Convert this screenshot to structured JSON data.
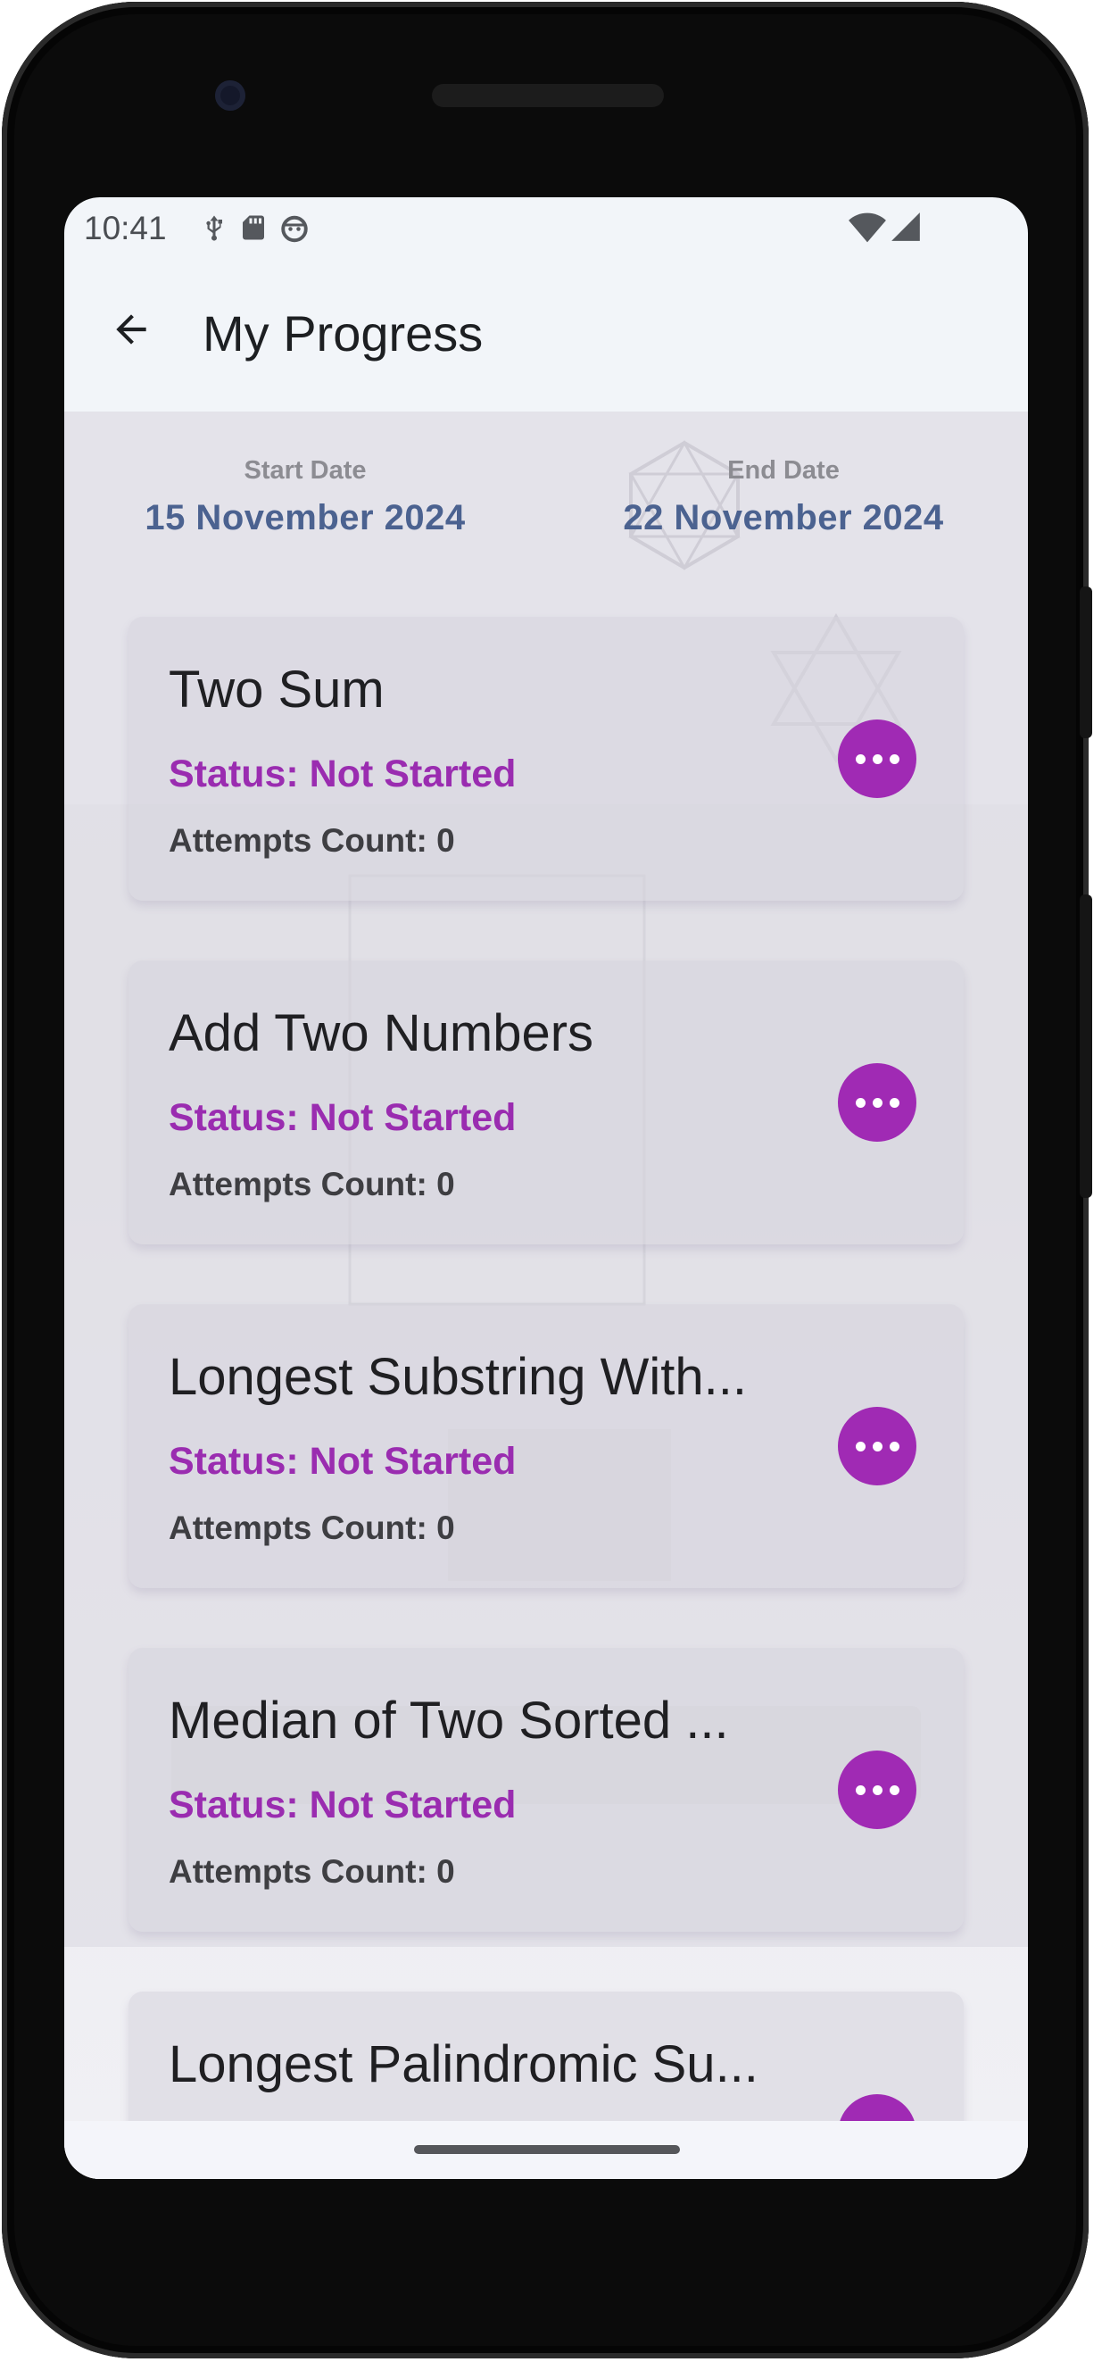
{
  "status_bar": {
    "time": "10:41",
    "left_icons": [
      "usb-debug-icon",
      "sd-card-icon",
      "android-icon"
    ],
    "right_icons": [
      "wifi-icon",
      "cell-signal-icon"
    ]
  },
  "app_bar": {
    "back_icon": "arrow-back-icon",
    "title": "My Progress"
  },
  "date_range": {
    "start_label": "Start Date",
    "start_value": "15 November 2024",
    "end_label": "End Date",
    "end_value": "22 November 2024"
  },
  "problems": [
    {
      "title": "Two Sum",
      "status": "Status: Not Started",
      "attempts": "Attempts Count: 0"
    },
    {
      "title": "Add Two Numbers",
      "status": "Status: Not Started",
      "attempts": "Attempts Count: 0"
    },
    {
      "title": "Longest Substring With...",
      "status": "Status: Not Started",
      "attempts": "Attempts Count: 0"
    },
    {
      "title": "Median of Two Sorted ...",
      "status": "Status: Not Started",
      "attempts": "Attempts Count: 0"
    },
    {
      "title": "Longest Palindromic Su...",
      "status": "",
      "attempts": ""
    }
  ],
  "colors": {
    "accent": "#a02ab4",
    "status_text": "#9a2cb0",
    "date_value": "#4b6290",
    "screen_bg": "#f2f5f9"
  }
}
